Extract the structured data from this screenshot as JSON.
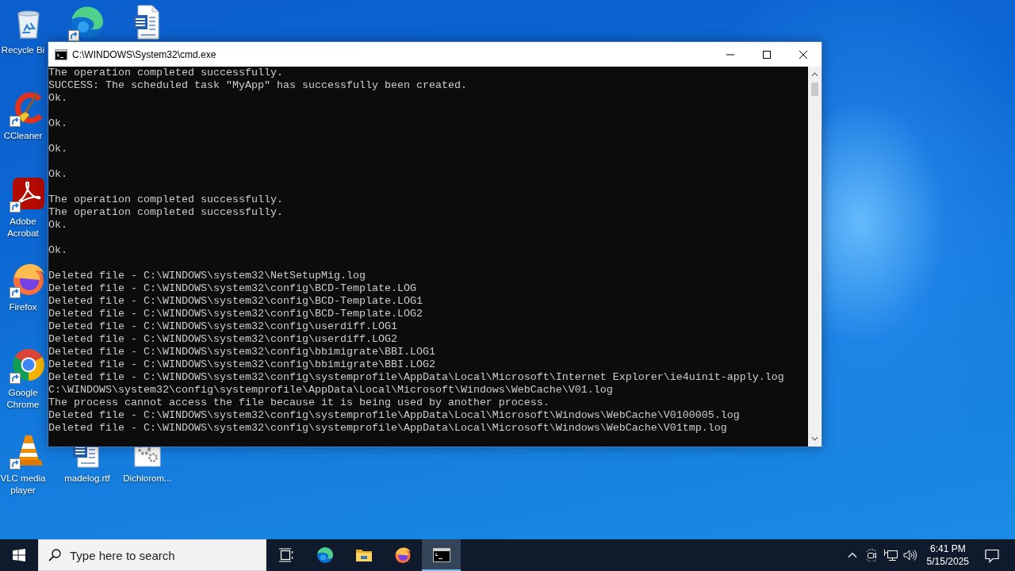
{
  "desktop": {
    "icon_rows": [
      [
        {
          "kind": "recycle_bin",
          "label": "Recycle Bi",
          "shortcut": false
        },
        {
          "kind": "edge",
          "shortcut": true
        },
        {
          "kind": "word_doc",
          "shortcut": false
        }
      ],
      [
        {
          "kind": "ccleaner",
          "label": "CCleaner",
          "shortcut": true
        }
      ],
      [
        {
          "kind": "acrobat",
          "label": "Adobe Acrobat",
          "shortcut": true
        }
      ],
      [
        {
          "kind": "firefox",
          "label": "Firefox",
          "shortcut": true
        }
      ],
      [
        {
          "kind": "chrome",
          "label": "Google Chrome",
          "shortcut": true
        }
      ],
      [
        {
          "kind": "vlc",
          "label": "VLC media player",
          "shortcut": true
        },
        {
          "kind": "word_doc",
          "label": "madelog.rtf",
          "shortcut": false
        },
        {
          "kind": "settings_doc",
          "label": "Dichlorom...",
          "shortcut": false
        }
      ]
    ]
  },
  "window": {
    "title": "C:\\WINDOWS\\System32\\cmd.exe",
    "console": {
      "blocks": [
        [
          "The operation completed successfully.",
          "SUCCESS: The scheduled task \"MyApp\" has successfully been created.",
          "Ok."
        ],
        [
          "Ok."
        ],
        [
          "Ok."
        ],
        [
          "Ok."
        ],
        [
          "The operation completed successfully.",
          "The operation completed successfully.",
          "Ok."
        ],
        [
          "Ok."
        ],
        [
          "Deleted file - C:\\WINDOWS\\system32\\NetSetupMig.log",
          "Deleted file - C:\\WINDOWS\\system32\\config\\BCD-Template.LOG",
          "Deleted file - C:\\WINDOWS\\system32\\config\\BCD-Template.LOG1",
          "Deleted file - C:\\WINDOWS\\system32\\config\\BCD-Template.LOG2",
          "Deleted file - C:\\WINDOWS\\system32\\config\\userdiff.LOG1",
          "Deleted file - C:\\WINDOWS\\system32\\config\\userdiff.LOG2",
          "Deleted file - C:\\WINDOWS\\system32\\config\\bbimigrate\\BBI.LOG1",
          "Deleted file - C:\\WINDOWS\\system32\\config\\bbimigrate\\BBI.LOG2",
          "Deleted file - C:\\WINDOWS\\system32\\config\\systemprofile\\AppData\\Local\\Microsoft\\Internet Explorer\\ie4uinit-apply.log",
          "C:\\WINDOWS\\system32\\config\\systemprofile\\AppData\\Local\\Microsoft\\Windows\\WebCache\\V01.log",
          "The process cannot access the file because it is being used by another process.",
          "Deleted file - C:\\WINDOWS\\system32\\config\\systemprofile\\AppData\\Local\\Microsoft\\Windows\\WebCache\\V0100005.log",
          "Deleted file - C:\\WINDOWS\\system32\\config\\systemprofile\\AppData\\Local\\Microsoft\\Windows\\WebCache\\V01tmp.log"
        ]
      ]
    }
  },
  "taskbar": {
    "search": {
      "placeholder": "Type here to search"
    },
    "apps": [
      {
        "kind": "edge",
        "selected": false
      },
      {
        "kind": "file_explorer",
        "selected": false
      },
      {
        "kind": "firefox",
        "selected": false
      },
      {
        "kind": "console",
        "selected": true
      }
    ],
    "clock": {
      "time": "6:41 PM",
      "date": "5/15/2025"
    }
  }
}
